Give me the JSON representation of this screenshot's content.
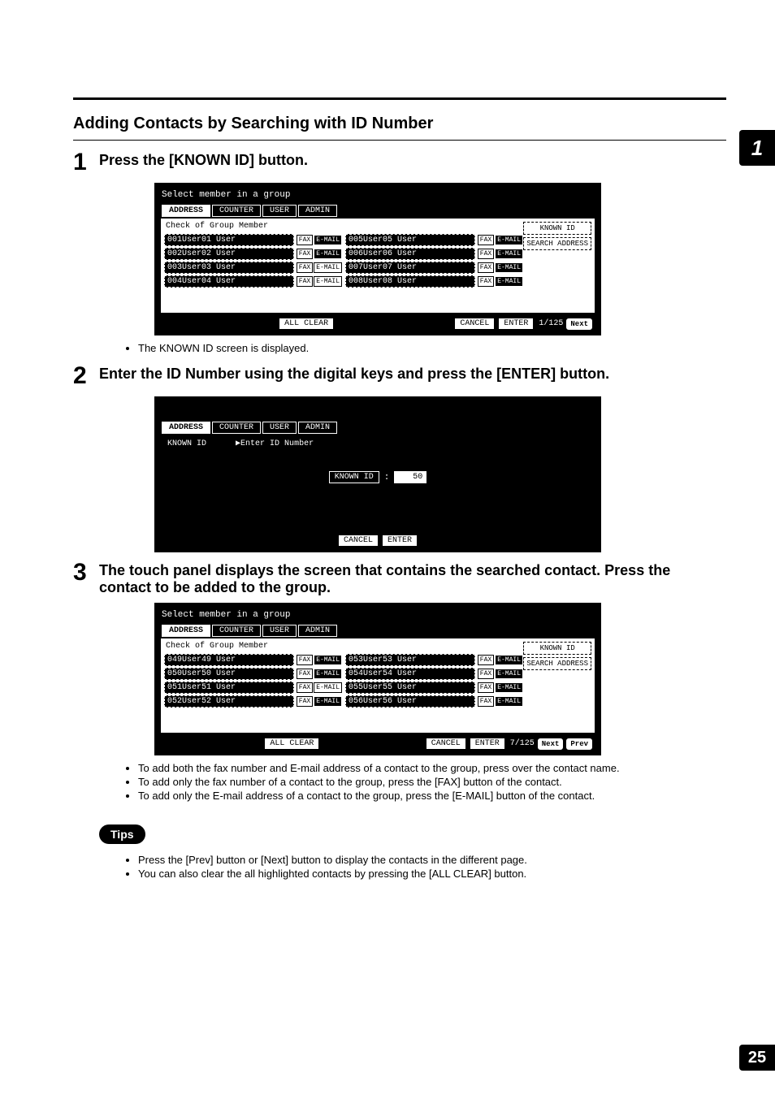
{
  "sideTab": "1",
  "pageNumber": "25",
  "sectionTitle": "Adding Contacts by Searching with ID Number",
  "steps": {
    "s1": {
      "num": "1",
      "text": "Press the [KNOWN ID] button."
    },
    "s2": {
      "num": "2",
      "text": "Enter the ID Number using the digital keys and press the [ENTER] button."
    },
    "s3": {
      "num": "3",
      "text": "The touch panel displays the screen that contains the searched contact.  Press the contact to be added to the group."
    }
  },
  "screen1": {
    "title": "Select member in a group",
    "tabs": {
      "address": "ADDRESS",
      "counter": "COUNTER",
      "user": "USER",
      "admin": "ADMIN"
    },
    "panelTitle": "Check of Group Member",
    "sideButtons": {
      "known": "KNOWN ID",
      "search": "SEARCH ADDRESS"
    },
    "leftEntries": {
      "e1": {
        "id": "001",
        "name": "User01 User"
      },
      "e2": {
        "id": "002",
        "name": "User02 User"
      },
      "e3": {
        "id": "003",
        "name": "User03 User"
      },
      "e4": {
        "id": "004",
        "name": "User04 User"
      }
    },
    "rightEntries": {
      "e1": {
        "id": "005",
        "name": "User05 User"
      },
      "e2": {
        "id": "006",
        "name": "User06 User"
      },
      "e3": {
        "id": "007",
        "name": "User07 User"
      },
      "e4": {
        "id": "008",
        "name": "User08 User"
      }
    },
    "miniBtns": {
      "fax": "FAX",
      "email": "E-MAIL"
    },
    "bottom": {
      "allClear": "ALL CLEAR",
      "cancel": "CANCEL",
      "enter": "ENTER",
      "page": "1/125",
      "next": "Next"
    }
  },
  "note1": "The KNOWN ID screen is displayed.",
  "screen2": {
    "tabs": {
      "address": "ADDRESS",
      "counter": "COUNTER",
      "user": "USER",
      "admin": "ADMIN"
    },
    "leftLabel": "KNOWN ID",
    "prompt": "▶Enter ID Number",
    "fieldLabel": "KNOWN ID",
    "colon": ":",
    "value": "50",
    "bottom": {
      "cancel": "CANCEL",
      "enter": "ENTER"
    }
  },
  "screen3": {
    "title": "Select member in a group",
    "tabs": {
      "address": "ADDRESS",
      "counter": "COUNTER",
      "user": "USER",
      "admin": "ADMIN"
    },
    "panelTitle": "Check of Group Member",
    "sideButtons": {
      "known": "KNOWN ID",
      "search": "SEARCH ADDRESS"
    },
    "leftEntries": {
      "e1": {
        "id": "049",
        "name": "User49 User"
      },
      "e2": {
        "id": "050",
        "name": "User50 User"
      },
      "e3": {
        "id": "051",
        "name": "User51 User"
      },
      "e4": {
        "id": "052",
        "name": "User52 User"
      }
    },
    "rightEntries": {
      "e1": {
        "id": "053",
        "name": "User53 User"
      },
      "e2": {
        "id": "054",
        "name": "User54 User"
      },
      "e3": {
        "id": "055",
        "name": "User55 User"
      },
      "e4": {
        "id": "056",
        "name": "User56 User"
      }
    },
    "miniBtns": {
      "fax": "FAX",
      "email": "E-MAIL"
    },
    "bottom": {
      "allClear": "ALL CLEAR",
      "cancel": "CANCEL",
      "enter": "ENTER",
      "page": "7/125",
      "next": "Next",
      "prev": "Prev"
    }
  },
  "notes3": {
    "n1": "To add both the fax number and E-mail address of a contact to the group, press over the contact name.",
    "n2": "To add only the fax number of a contact to the group, press the [FAX] button of the contact.",
    "n3": "To add only the E-mail address of a contact to the group, press the [E-MAIL] button of the contact."
  },
  "tipsLabel": "Tips",
  "tips": {
    "t1": "Press the [Prev] button or [Next] button to display the contacts in the different page.",
    "t2": "You can also clear the all highlighted contacts by pressing the [ALL CLEAR] button."
  }
}
